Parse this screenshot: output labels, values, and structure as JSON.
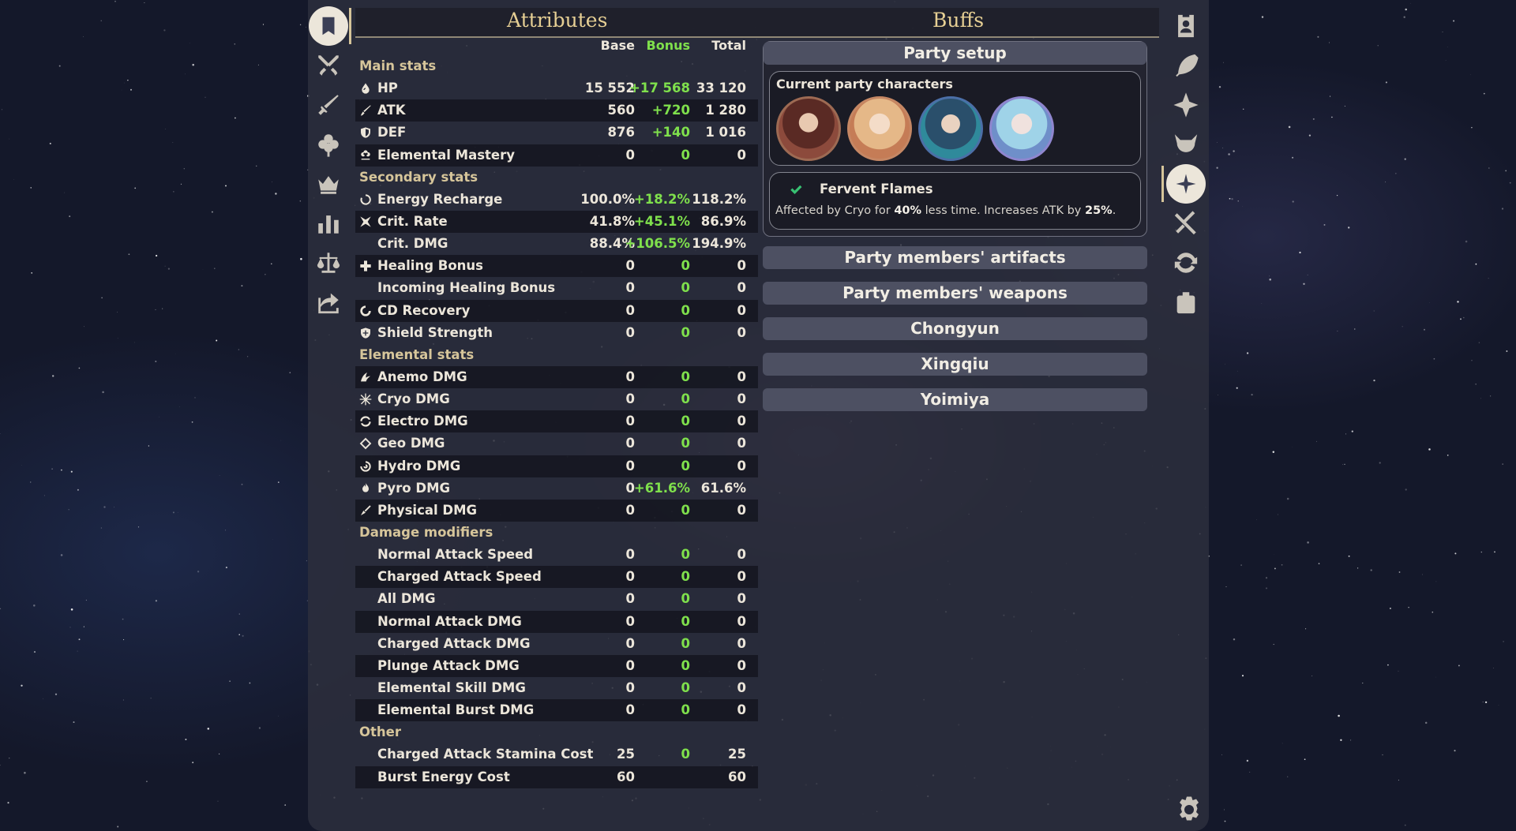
{
  "left_rail": [
    {
      "name": "character-sheet-icon",
      "active": true
    },
    {
      "name": "crossed-swords-icon"
    },
    {
      "name": "sword-icon"
    },
    {
      "name": "artifact-flower-icon"
    },
    {
      "name": "crown-icon"
    },
    {
      "name": "bar-chart-icon"
    },
    {
      "name": "scales-icon"
    },
    {
      "name": "share-icon"
    }
  ],
  "right_rail": [
    {
      "name": "character-card-icon"
    },
    {
      "name": "weapon-feather-icon"
    },
    {
      "name": "elemental-compass-icon"
    },
    {
      "name": "enemy-helmet-icon"
    },
    {
      "name": "sparkle-buff-icon",
      "active": true
    },
    {
      "name": "food-utensils-icon"
    },
    {
      "name": "reaction-cycle-icon"
    },
    {
      "name": "backpack-icon"
    }
  ],
  "header": {
    "attributes_title": "Attributes",
    "buffs_title": "Buffs"
  },
  "table": {
    "col_base": "Base",
    "col_bonus": "Bonus",
    "col_total": "Total",
    "sections": [
      {
        "title": "Main stats",
        "rows": [
          {
            "icon": "hp-drop-icon",
            "label": "HP",
            "base": "15 552",
            "bonus": "+17 568",
            "total": "33 120"
          },
          {
            "icon": "atk-sword-icon",
            "label": "ATK",
            "base": "560",
            "bonus": "+720",
            "total": "1 280"
          },
          {
            "icon": "def-shield-icon",
            "label": "DEF",
            "base": "876",
            "bonus": "+140",
            "total": "1 016"
          },
          {
            "icon": "elemental-mastery-icon",
            "label": "Elemental Mastery",
            "base": "0",
            "bonus": "0",
            "total": "0"
          }
        ]
      },
      {
        "title": "Secondary stats",
        "rows": [
          {
            "icon": "energy-recharge-icon",
            "label": "Energy Recharge",
            "base": "100.0%",
            "bonus": "+18.2%",
            "total": "118.2%"
          },
          {
            "icon": "crit-rate-icon",
            "label": "Crit. Rate",
            "base": "41.8%",
            "bonus": "+45.1%",
            "total": "86.9%"
          },
          {
            "icon": "",
            "label": "Crit. DMG",
            "base": "88.4%",
            "bonus": "+106.5%",
            "total": "194.9%"
          },
          {
            "icon": "healing-plus-icon",
            "label": "Healing Bonus",
            "base": "0",
            "bonus": "0",
            "total": "0"
          },
          {
            "icon": "",
            "label": "Incoming Healing Bonus",
            "base": "0",
            "bonus": "0",
            "total": "0"
          },
          {
            "icon": "cd-recovery-icon",
            "label": "CD Recovery",
            "base": "0",
            "bonus": "0",
            "total": "0"
          },
          {
            "icon": "shield-strength-icon",
            "label": "Shield Strength",
            "base": "0",
            "bonus": "0",
            "total": "0"
          }
        ]
      },
      {
        "title": "Elemental stats",
        "rows": [
          {
            "icon": "anemo-icon",
            "label": "Anemo DMG",
            "base": "0",
            "bonus": "0",
            "total": "0"
          },
          {
            "icon": "cryo-icon",
            "label": "Cryo DMG",
            "base": "0",
            "bonus": "0",
            "total": "0"
          },
          {
            "icon": "electro-icon",
            "label": "Electro DMG",
            "base": "0",
            "bonus": "0",
            "total": "0"
          },
          {
            "icon": "geo-icon",
            "label": "Geo DMG",
            "base": "0",
            "bonus": "0",
            "total": "0"
          },
          {
            "icon": "hydro-icon",
            "label": "Hydro DMG",
            "base": "0",
            "bonus": "0",
            "total": "0"
          },
          {
            "icon": "pyro-icon",
            "label": "Pyro DMG",
            "base": "0",
            "bonus": "+61.6%",
            "total": "61.6%"
          },
          {
            "icon": "physical-icon",
            "label": "Physical DMG",
            "base": "0",
            "bonus": "0",
            "total": "0"
          }
        ]
      },
      {
        "title": "Damage modifiers",
        "rows": [
          {
            "icon": "",
            "label": "Normal Attack Speed",
            "base": "0",
            "bonus": "0",
            "total": "0"
          },
          {
            "icon": "",
            "label": "Charged Attack Speed",
            "base": "0",
            "bonus": "0",
            "total": "0"
          },
          {
            "icon": "",
            "label": "All DMG",
            "base": "0",
            "bonus": "0",
            "total": "0"
          },
          {
            "icon": "",
            "label": "Normal Attack DMG",
            "base": "0",
            "bonus": "0",
            "total": "0"
          },
          {
            "icon": "",
            "label": "Charged Attack DMG",
            "base": "0",
            "bonus": "0",
            "total": "0"
          },
          {
            "icon": "",
            "label": "Plunge Attack DMG",
            "base": "0",
            "bonus": "0",
            "total": "0"
          },
          {
            "icon": "",
            "label": "Elemental Skill DMG",
            "base": "0",
            "bonus": "0",
            "total": "0"
          },
          {
            "icon": "",
            "label": "Elemental Burst DMG",
            "base": "0",
            "bonus": "0",
            "total": "0"
          }
        ]
      },
      {
        "title": "Other",
        "rows": [
          {
            "icon": "",
            "label": "Charged Attack Stamina Cost",
            "base": "25",
            "bonus": "0",
            "total": "25"
          },
          {
            "icon": "",
            "label": "Burst Energy Cost",
            "base": "60",
            "bonus": "",
            "total": "60"
          }
        ]
      }
    ]
  },
  "buffs": {
    "party_setup": "Party setup",
    "current_party_label": "Current party characters",
    "avatars": [
      "party-avatar-1",
      "party-avatar-2",
      "party-avatar-3",
      "party-avatar-4"
    ],
    "fervent": {
      "title": "Fervent Flames",
      "desc_1": "Affected by Cryo for ",
      "desc_2": "40%",
      "desc_3": " less time. Increases ATK by ",
      "desc_4": "25%",
      "desc_5": "."
    },
    "sections": [
      "Party members' artifacts",
      "Party members' weapons",
      "Chongyun",
      "Xingqiu",
      "Yoimiya"
    ]
  },
  "colors": {
    "accent": "#d6c59a",
    "bonus_green": "#7fe04c",
    "title_gold": "#e6cf94"
  }
}
